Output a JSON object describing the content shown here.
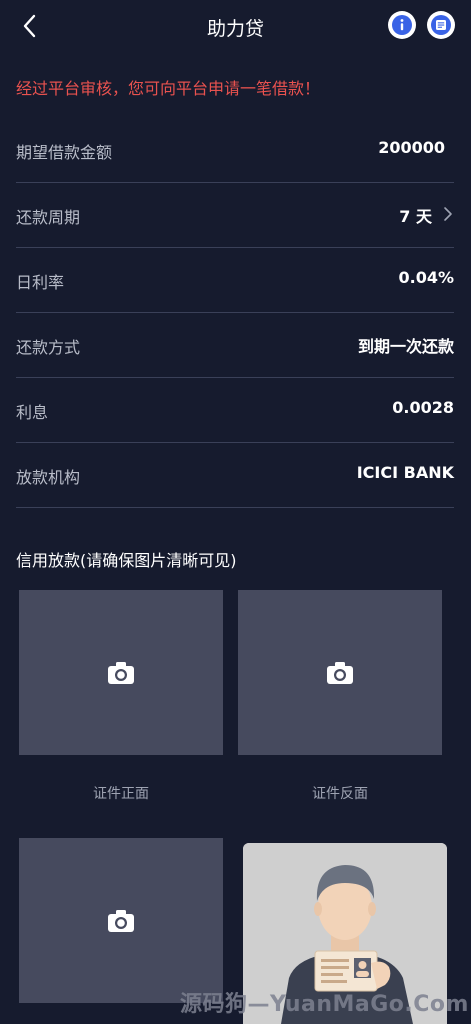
{
  "header": {
    "title": "助力贷",
    "back_icon": "chevron-left-icon",
    "info_icon": "info-icon",
    "list_icon": "document-icon"
  },
  "notice": "经过平台审核，您可向平台申请一笔借款！",
  "rows": [
    {
      "label": "期望借款金额",
      "value": "200000"
    },
    {
      "label": "还款周期",
      "value": "7 天"
    },
    {
      "label": "日利率",
      "value": "0.04%"
    },
    {
      "label": "还款方式",
      "value": "到期一次还款"
    },
    {
      "label": "利息",
      "value": "0.0028"
    },
    {
      "label": "放款机构",
      "value": "ICICI BANK"
    }
  ],
  "upload_section": {
    "title": "信用放款(请确保图片清晰可见)",
    "front_caption": "证件正面",
    "back_caption": "证件反面"
  },
  "watermark": "源码狗—YuanMaGo.Com",
  "colors": {
    "background": "#161b2e",
    "notice": "#e9524f",
    "upload_box": "#464a5e",
    "accent_blue": "#3a63e6"
  }
}
